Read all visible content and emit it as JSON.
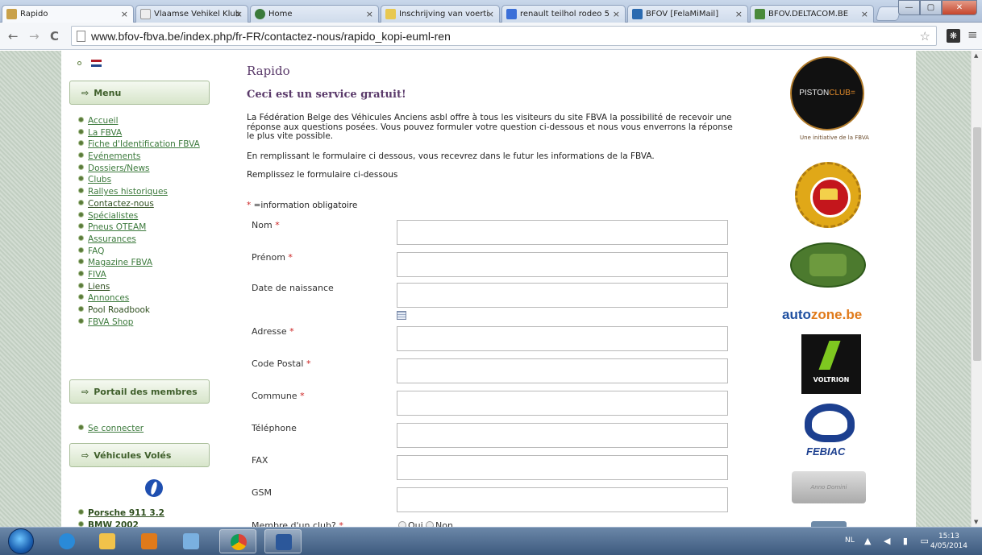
{
  "browser": {
    "tabs": [
      {
        "title": "Rapido",
        "color": "#c9a14a"
      },
      {
        "title": "Vlaamse Vehikel Klub",
        "color": "#eeeeee"
      },
      {
        "title": "Home",
        "color": "#3a7a3a"
      },
      {
        "title": "Inschrijving van voerti",
        "color": "#e8c850"
      },
      {
        "title": "renault teilhol rodeo 5",
        "color": "#3b6fd8"
      },
      {
        "title": "BFOV [FelaMiMail]",
        "color": "#2a6ab0"
      },
      {
        "title": "BFOV.DELTACOM.BE",
        "color": "#4a8a3a"
      }
    ],
    "url": "www.bfov-fbva.be/index.php/fr-FR/contactez-nous/rapido_kopi-euml-ren",
    "ext_label": "❋",
    "window_buttons": {
      "min": "—",
      "max": "▢",
      "close": "✕"
    }
  },
  "sidebar": {
    "menu_title": "Menu",
    "menu_items": [
      "Accueil",
      "La FBVA",
      "Fiche d'Identification FBVA",
      "Evénements",
      "Dossiers/News",
      "Clubs",
      "Rallyes historiques",
      "Contactez-nous",
      "Spécialistes",
      "Pneus OTEAM",
      "Assurances",
      "FAQ",
      "Magazine FBVA",
      "FIVA",
      "Liens",
      "Annonces",
      "Pool Roadbook",
      "FBVA Shop"
    ],
    "members_title": "Portail des membres",
    "login_link": "Se connecter",
    "stolen_title": "Véhicules Volés",
    "stolen_items": [
      "Porsche 911 3.2",
      "BMW 2002"
    ]
  },
  "main": {
    "title": "Rapido",
    "subtitle": "Ceci est un service gratuit!",
    "intro": "La Fédération Belge des Véhicules Anciens asbl offre à tous les visiteurs du site FBVA la possibilité de recevoir une réponse aux questions posées. Vous pouvez formuler votre question ci-dessous et nous vous enverrons la réponse le plus vite possible.",
    "info": "En remplissant le formulaire ci dessous, vous recevrez dans le futur les informations de la FBVA.",
    "fill_prompt": "Remplissez le formulaire ci-dessous",
    "required_note": "=information obligatoire",
    "fields": [
      {
        "label": "Nom",
        "required": true,
        "value": ""
      },
      {
        "label": "Prénom",
        "required": true,
        "value": ""
      },
      {
        "label": "Date de naissance",
        "required": false,
        "value": ""
      },
      {
        "label": "Adresse",
        "required": true,
        "value": ""
      },
      {
        "label": "Code Postal",
        "required": true,
        "value": ""
      },
      {
        "label": "Commune",
        "required": true,
        "value": ""
      },
      {
        "label": "Téléphone",
        "required": false,
        "value": ""
      },
      {
        "label": "FAX",
        "required": false,
        "value": ""
      },
      {
        "label": "GSM",
        "required": false,
        "value": ""
      }
    ],
    "club_question": "Membre d'un club?",
    "club_options": [
      "Oui",
      "Non"
    ]
  },
  "sponsors": {
    "pistonclub": {
      "text1": "PISTON",
      "text2": "CLUB="
    },
    "pistonclub_caption": "Une initiative de la FBVA",
    "autozone": {
      "part1": "auto",
      "part2": "zone.be"
    },
    "voltrion": "VOLTRION",
    "febiac": "FEBIAC",
    "plate": "Anno Domini"
  },
  "taskbar": {
    "lang": "NL",
    "tray_icons": "▲ ◀ ▮ ▭",
    "time": "15:13",
    "date": "4/05/2014"
  }
}
